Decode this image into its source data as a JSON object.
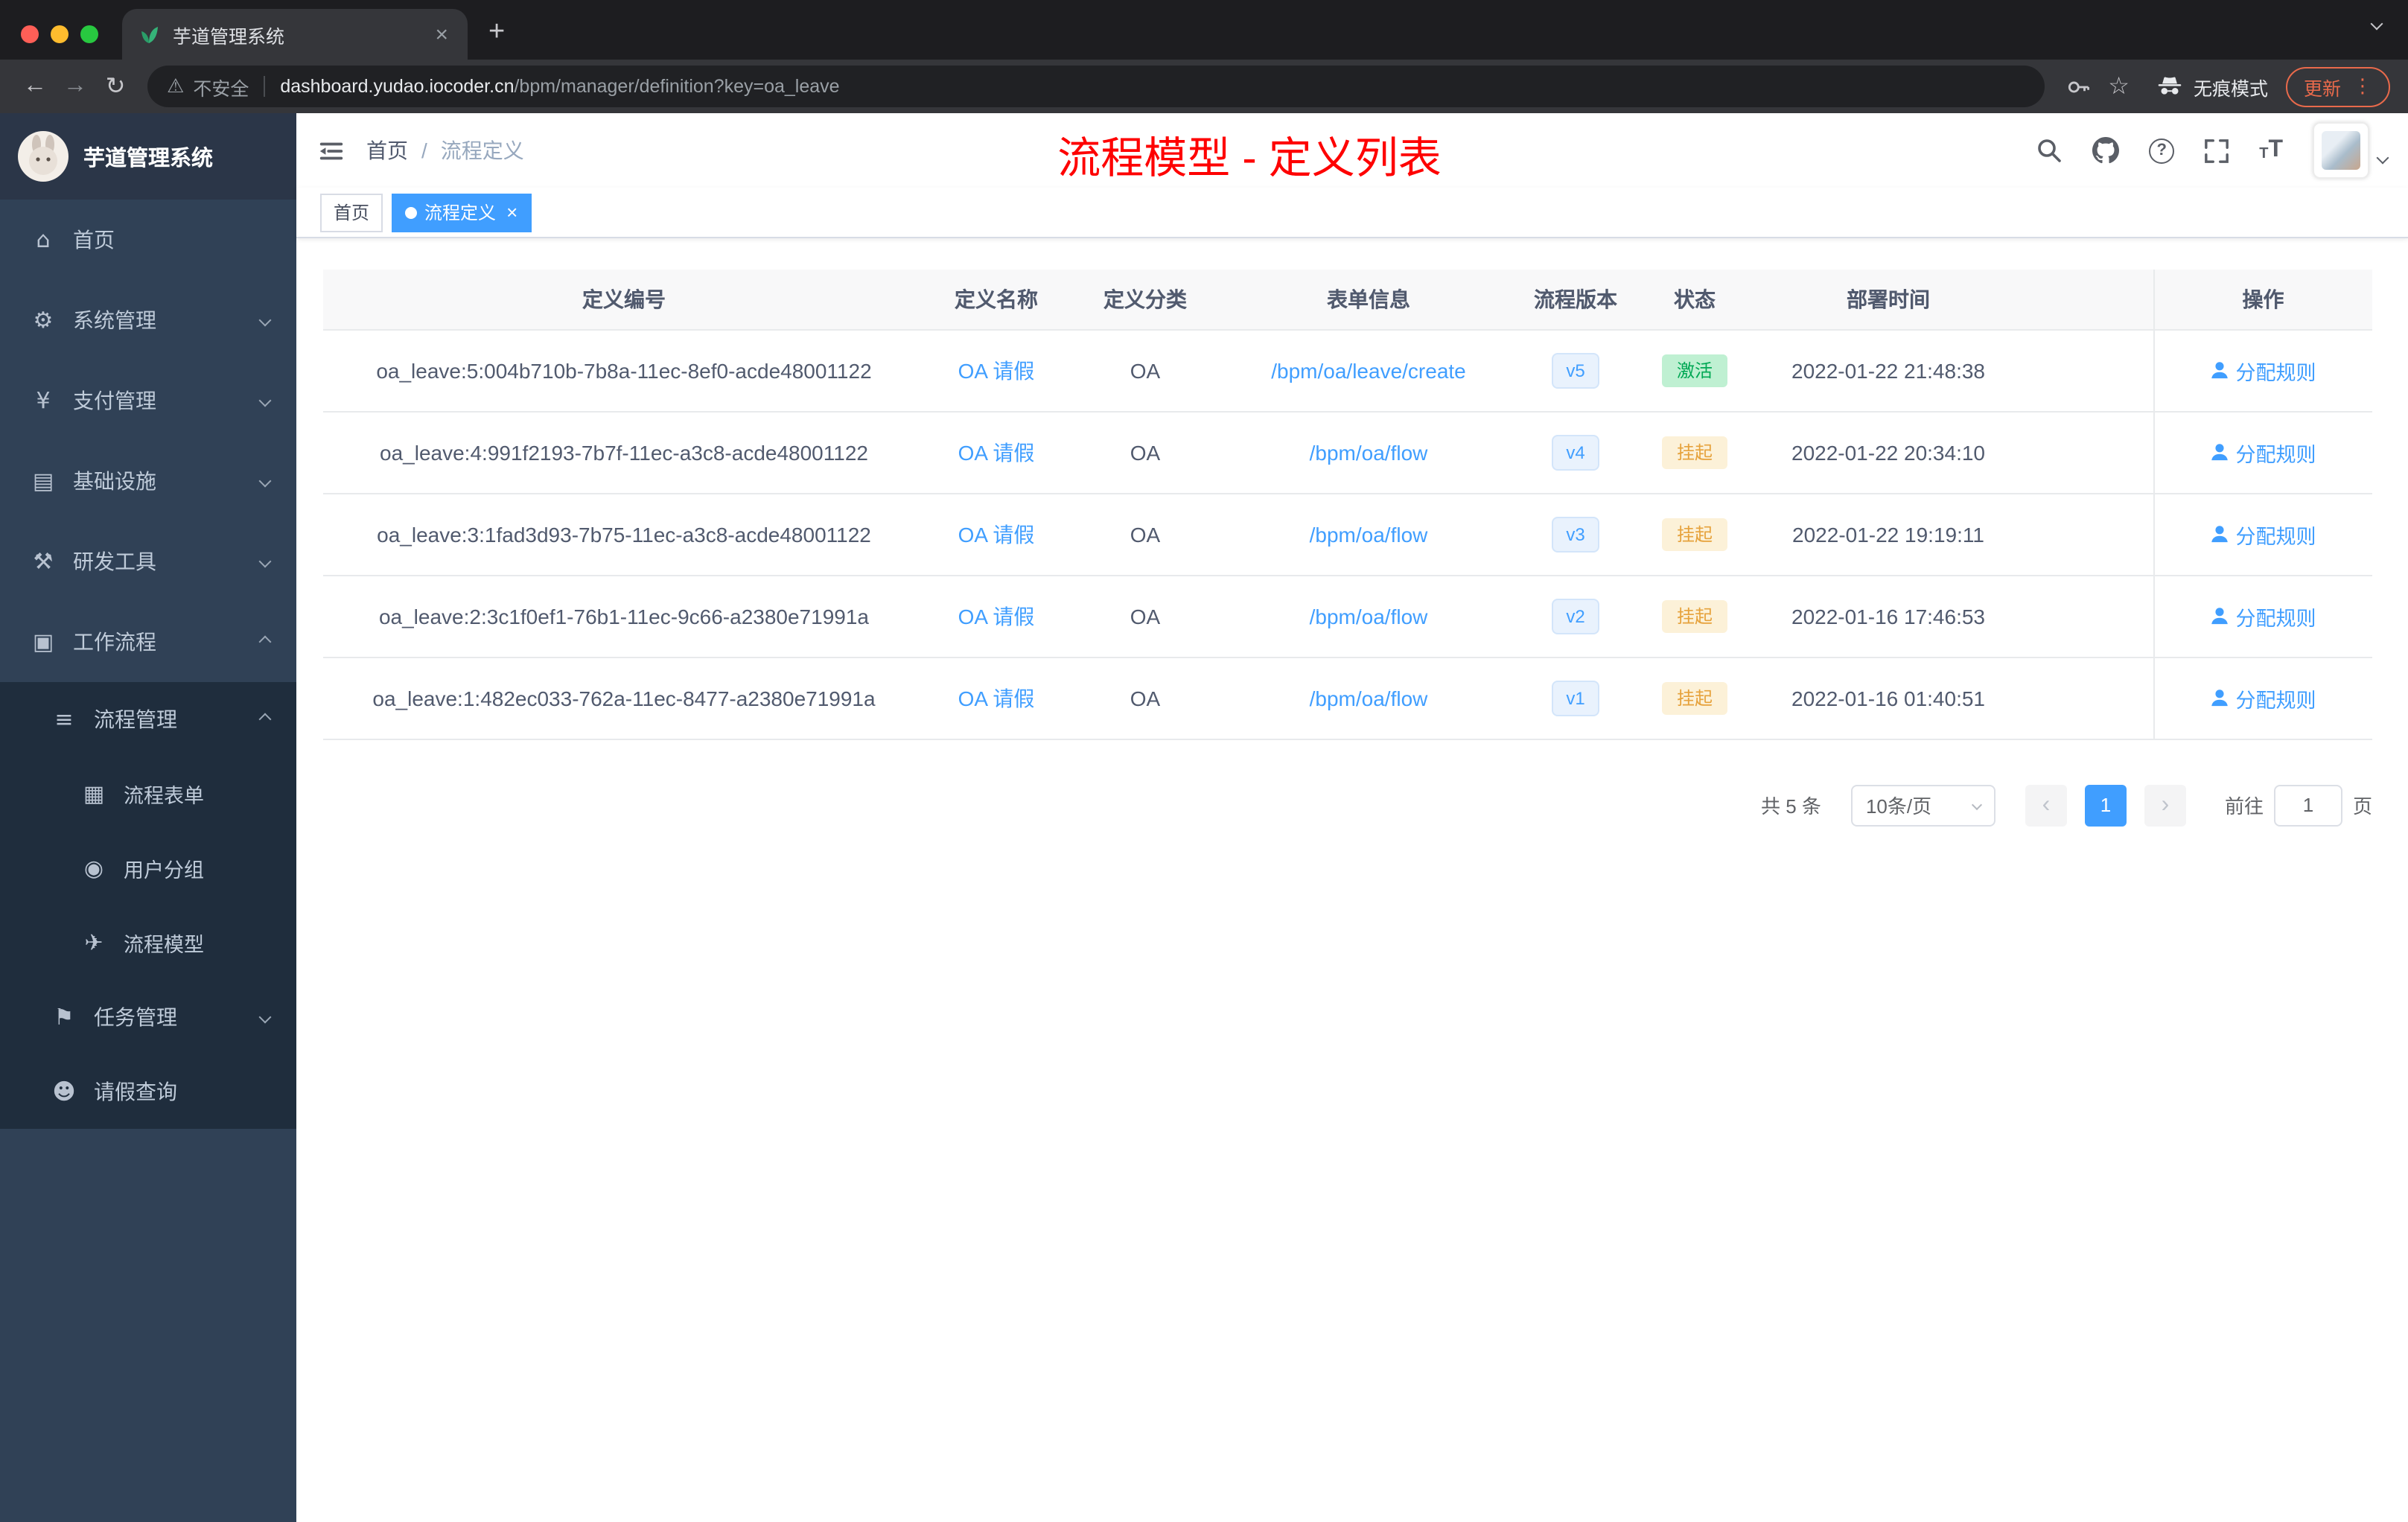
{
  "browser": {
    "tab_title": "芋道管理系统",
    "tab_close": "×",
    "new_tab": "+",
    "back": "←",
    "forward": "→",
    "reload": "↻",
    "warning": "⚠",
    "security_label": "不安全",
    "url_host": "dashboard.yudao.iocoder.cn",
    "url_path": "/bpm/manager/definition?key=oa_leave",
    "star": "☆",
    "incognito_label": "无痕模式",
    "update_label": "更新",
    "menu_dots": "⋮"
  },
  "sidebar": {
    "logo_title": "芋道管理系统",
    "items": [
      {
        "label": "首页",
        "icon": "⌂"
      },
      {
        "label": "系统管理",
        "icon": "⚙"
      },
      {
        "label": "支付管理",
        "icon": "¥"
      },
      {
        "label": "基础设施",
        "icon": "▤"
      },
      {
        "label": "研发工具",
        "icon": "⚒"
      },
      {
        "label": "工作流程",
        "icon": "▣"
      }
    ],
    "workflow_menu": {
      "process_management": {
        "label": "流程管理",
        "icon": "≡"
      },
      "children": [
        {
          "label": "流程表单",
          "icon": "▦"
        },
        {
          "label": "用户分组",
          "icon": "◉"
        },
        {
          "label": "流程模型",
          "icon": "✈"
        }
      ],
      "task_management": {
        "label": "任务管理",
        "icon": "⚑"
      },
      "leave_query": {
        "label": "请假查询",
        "icon": "☻"
      }
    }
  },
  "header": {
    "breadcrumb_home": "首页",
    "breadcrumb_separator": "/",
    "breadcrumb_current": "流程定义",
    "annotation": "流程模型 - 定义列表",
    "help": "?",
    "fontsize_small": "T",
    "fontsize_large": "T"
  },
  "tags": {
    "home": "首页",
    "active": "流程定义",
    "close": "×"
  },
  "table": {
    "columns": [
      "定义编号",
      "定义名称",
      "定义分类",
      "表单信息",
      "流程版本",
      "状态",
      "部署时间",
      "操作"
    ],
    "rows": [
      {
        "id": "oa_leave:5:004b710b-7b8a-11ec-8ef0-acde48001122",
        "name": "OA 请假",
        "category": "OA",
        "form": "/bpm/oa/leave/create",
        "version": "v5",
        "status": "激活",
        "time": "2022-01-22 21:48:38",
        "action": "分配规则"
      },
      {
        "id": "oa_leave:4:991f2193-7b7f-11ec-a3c8-acde48001122",
        "name": "OA 请假",
        "category": "OA",
        "form": "/bpm/oa/flow",
        "version": "v4",
        "status": "挂起",
        "time": "2022-01-22 20:34:10",
        "action": "分配规则"
      },
      {
        "id": "oa_leave:3:1fad3d93-7b75-11ec-a3c8-acde48001122",
        "name": "OA 请假",
        "category": "OA",
        "form": "/bpm/oa/flow",
        "version": "v3",
        "status": "挂起",
        "time": "2022-01-22 19:19:11",
        "action": "分配规则"
      },
      {
        "id": "oa_leave:2:3c1f0ef1-76b1-11ec-9c66-a2380e71991a",
        "name": "OA 请假",
        "category": "OA",
        "form": "/bpm/oa/flow",
        "version": "v2",
        "status": "挂起",
        "time": "2022-01-16 17:46:53",
        "action": "分配规则"
      },
      {
        "id": "oa_leave:1:482ec033-762a-11ec-8477-a2380e71991a",
        "name": "OA 请假",
        "category": "OA",
        "form": "/bpm/oa/flow",
        "version": "v1",
        "status": "挂起",
        "time": "2022-01-16 01:40:51",
        "action": "分配规则"
      }
    ]
  },
  "pagination": {
    "total": "共 5 条",
    "page_size": "10条/页",
    "prev": "‹",
    "page": "1",
    "next": "›",
    "goto_label": "前往",
    "goto_value": "1",
    "unit": "页"
  },
  "colors": {
    "accent": "#409eff",
    "sidebar_bg": "#304156",
    "submenu_bg": "#1f2d3d",
    "status_active_text": "#00a854",
    "status_suspend_text": "#e6a23c",
    "annotation_red": "#fe0000",
    "update_orange": "#e96a4b"
  }
}
